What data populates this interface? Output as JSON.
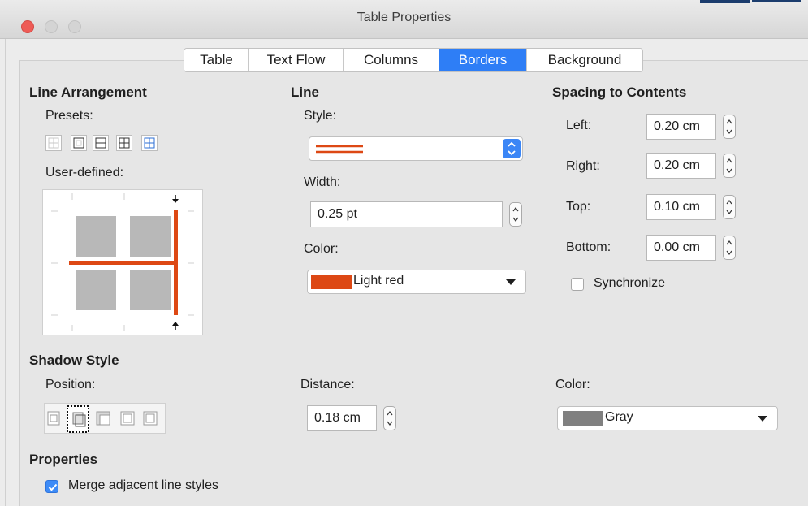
{
  "window": {
    "title": "Table Properties"
  },
  "tabs": [
    {
      "label": "Table"
    },
    {
      "label": "Text Flow"
    },
    {
      "label": "Columns"
    },
    {
      "label": "Borders",
      "active": true
    },
    {
      "label": "Background"
    }
  ],
  "line_arrangement": {
    "heading": "Line Arrangement",
    "presets_label": "Presets:",
    "user_defined_label": "User-defined:"
  },
  "line": {
    "heading": "Line",
    "style_label": "Style:",
    "width_label": "Width:",
    "width_value": "0.25 pt",
    "color_label": "Color:",
    "color_value": "Light red",
    "color_hex": "#dd4814"
  },
  "spacing": {
    "heading": "Spacing to Contents",
    "left_label": "Left:",
    "left_value": "0.20 cm",
    "right_label": "Right:",
    "right_value": "0.20 cm",
    "top_label": "Top:",
    "top_value": "0.10 cm",
    "bottom_label": "Bottom:",
    "bottom_value": "0.00 cm",
    "synchronize_label": "Synchronize",
    "synchronize_checked": false
  },
  "shadow": {
    "heading": "Shadow Style",
    "position_label": "Position:",
    "distance_label": "Distance:",
    "distance_value": "0.18 cm",
    "color_label": "Color:",
    "color_value": "Gray",
    "color_hex": "#808080"
  },
  "properties": {
    "heading": "Properties",
    "merge_label": "Merge adjacent line styles",
    "merge_checked": true
  },
  "colors": {
    "accent": "#2e7ef6",
    "line_red": "#dd4814"
  }
}
